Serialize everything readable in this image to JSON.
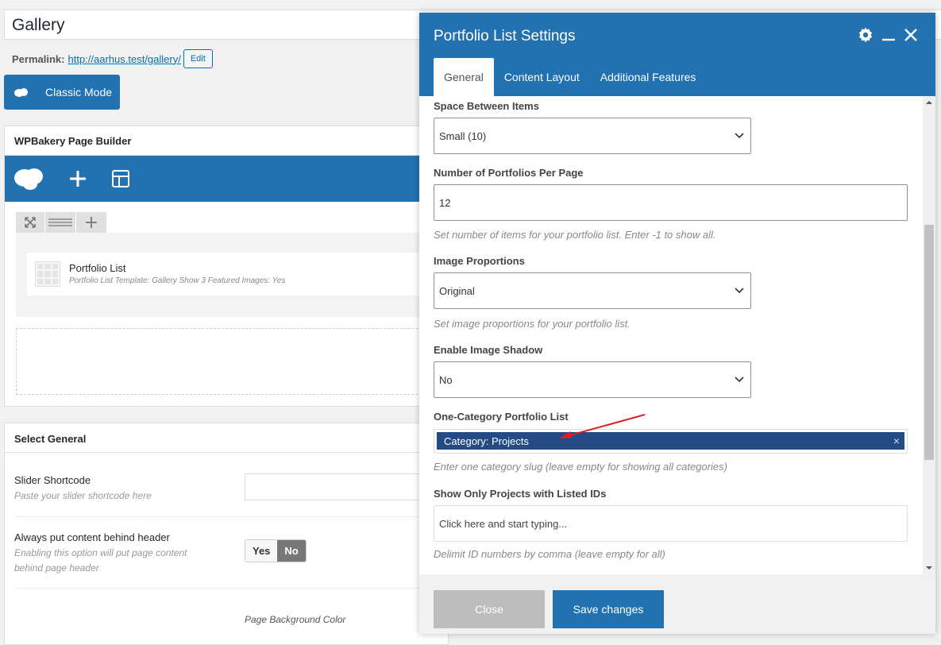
{
  "page": {
    "title_value": "Gallery",
    "permalink_label": "Permalink:",
    "permalink_url": "http://aarhus.test/gallery/",
    "edit_label": "Edit",
    "classic_mode_label": "Classic Mode"
  },
  "wpbakery": {
    "title": "WPBakery Page Builder",
    "element": {
      "title": "Portfolio List",
      "subtitle": "Portfolio List Template: Gallery  Show 3 Featured Images: Yes"
    }
  },
  "select_general": {
    "title": "Select General",
    "slider_label": "Slider Shortcode",
    "slider_desc": "Paste your slider shortcode here",
    "behind_header_label": "Always put content behind header",
    "behind_header_desc_1": "Enabling this option will put page content",
    "behind_header_desc_2": "behind page header",
    "toggle_yes": "Yes",
    "toggle_no": "No",
    "bg_color_label": "Page Background Color"
  },
  "modal": {
    "title": "Portfolio List Settings",
    "tabs": [
      "General",
      "Content Layout",
      "Additional Features"
    ],
    "fields": {
      "space_label": "Space Between Items",
      "space_value": "Small (10)",
      "per_page_label": "Number of Portfolios Per Page",
      "per_page_value": "12",
      "per_page_help": "Set number of items for your portfolio list. Enter -1 to show all.",
      "proportions_label": "Image Proportions",
      "proportions_value": "Original",
      "proportions_help": "Set image proportions for your portfolio list.",
      "shadow_label": "Enable Image Shadow",
      "shadow_value": "No",
      "category_label": "One-Category Portfolio List",
      "category_tag": "Category: Projects",
      "category_help": "Enter one category slug (leave empty for showing all categories)",
      "ids_label": "Show Only Projects with Listed IDs",
      "ids_placeholder": "Click here and start typing...",
      "ids_help": "Delimit ID numbers by comma (leave empty for all)"
    },
    "close_label": "Close",
    "save_label": "Save changes"
  },
  "colors": {
    "primary": "#2271b1",
    "tag_bg": "#234c86",
    "annotation_arrow": "#e02020"
  }
}
